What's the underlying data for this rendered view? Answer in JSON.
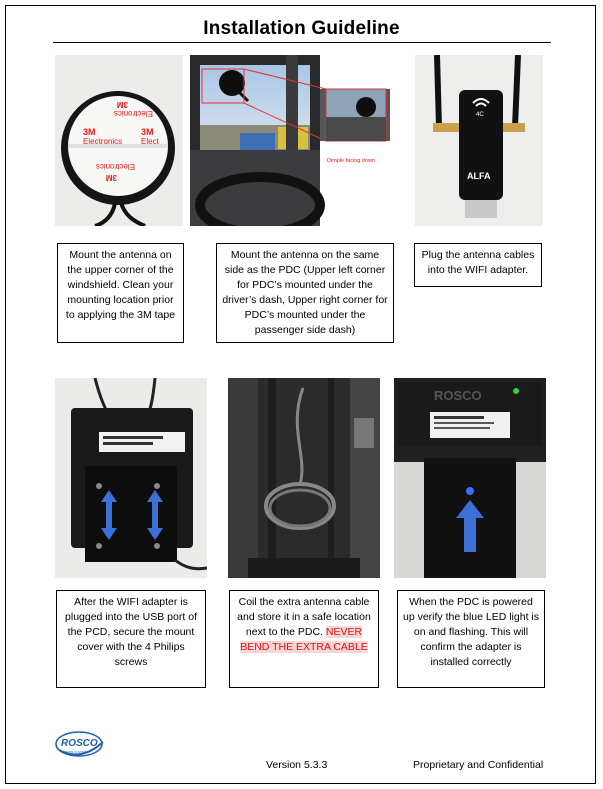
{
  "title": "Installation Guideline",
  "steps": [
    {
      "text": "Mount the antenna on the upper corner of the windshield. Clean your mounting location prior to applying the 3M tape"
    },
    {
      "text": "Mount the antenna on the same side as the PDC (Upper left corner for PDC’s mounted under the driver’s dash, Upper right corner for PDC’s mounted under the passenger side dash)"
    },
    {
      "text": "Plug the antenna cables into the WIFI adapter."
    },
    {
      "text": "After the WIFI adapter is plugged into the USB port of the PCD, secure the mount cover with the 4 Philips screws"
    },
    {
      "text": "Coil the extra antenna cable and store it in a safe location next to the PDC.",
      "warning": "NEVER BEND THE EXTRA CABLE"
    },
    {
      "text": "When the PDC is powered up verify the blue LED light is on and flashing. This will confirm the adapter is installed correctly"
    }
  ],
  "photo_labels": {
    "dimple": "Dimple facing down",
    "tape_3m": "3M",
    "tape_electronics": "Electronics",
    "tape_elect": "Elect",
    "alfa": "ALFA",
    "wifi_4c": "4C",
    "rosco_device": "ROSCO"
  },
  "footer": {
    "version": "Version 5.3.3",
    "confidential": "Proprietary and Confidential",
    "logo_text": "ROSCO",
    "logo_sub": "VISION SYSTEMS"
  },
  "colors": {
    "warning": "#e01010",
    "arrow_blue": "#3d6fd6",
    "logo_blue": "#1f5fb0"
  }
}
